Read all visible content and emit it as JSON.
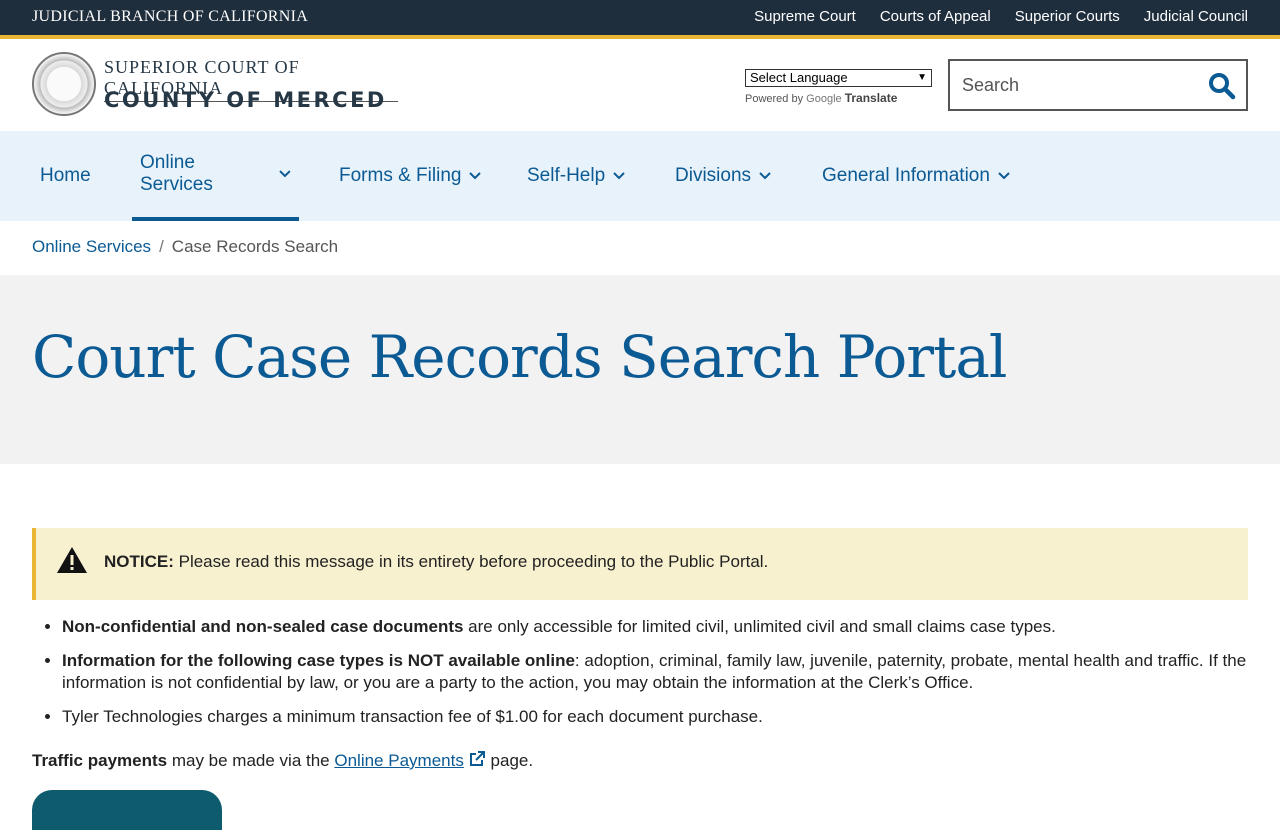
{
  "top_bar": {
    "branch": "JUDICIAL BRANCH OF CALIFORNIA",
    "links": [
      "Supreme Court",
      "Courts of Appeal",
      "Superior Courts",
      "Judicial Council"
    ]
  },
  "header": {
    "court_line1": "SUPERIOR COURT OF CALIFORNIA",
    "court_line2": "COUNTY OF MERCED",
    "language_select": "Select Language",
    "powered_by": "Powered by",
    "google": "Google",
    "translate": "Translate",
    "search_placeholder": "Search"
  },
  "nav": {
    "items": [
      {
        "label": "Home",
        "dropdown": false,
        "active": false
      },
      {
        "label": "Online Services",
        "dropdown": true,
        "active": true
      },
      {
        "label": "Forms & Filing",
        "dropdown": true,
        "active": false
      },
      {
        "label": "Self-Help",
        "dropdown": true,
        "active": false
      },
      {
        "label": "Divisions",
        "dropdown": true,
        "active": false
      },
      {
        "label": "General Information",
        "dropdown": true,
        "active": false
      }
    ]
  },
  "breadcrumb": {
    "parent": "Online Services",
    "separator": "/",
    "current": "Case Records Search"
  },
  "page_title": "Court Case Records Search Portal",
  "notice": {
    "label": "NOTICE:",
    "text": " Please read this message in its entirety before proceeding to the Public Portal."
  },
  "bullets": [
    {
      "bold": "Non-confidential and non-sealed case documents",
      "text": " are only accessible for limited civil, unlimited civil and small claims case types."
    },
    {
      "bold": "Information for the following case types is NOT available online",
      "text": ":  adoption, criminal, family law, juvenile, paternity, probate, mental health and traffic. If the information is not confidential by law, or you are a party to the action, you may obtain the information at the Clerk’s Office."
    },
    {
      "bold": "",
      "text": "Tyler Technologies charges a minimum transaction fee of $1.00 for each document purchase."
    }
  ],
  "traffic": {
    "bold": "Traffic payments",
    "text1": " may be made via the ",
    "link": "Online Payments",
    "text2": " page."
  },
  "colors": {
    "brand_blue": "#0b5a94",
    "top_bar": "#1f2e3d",
    "accent_gold": "#e8b634",
    "nav_bg": "#e8f2fa",
    "notice_bg": "#f8f1d0"
  }
}
